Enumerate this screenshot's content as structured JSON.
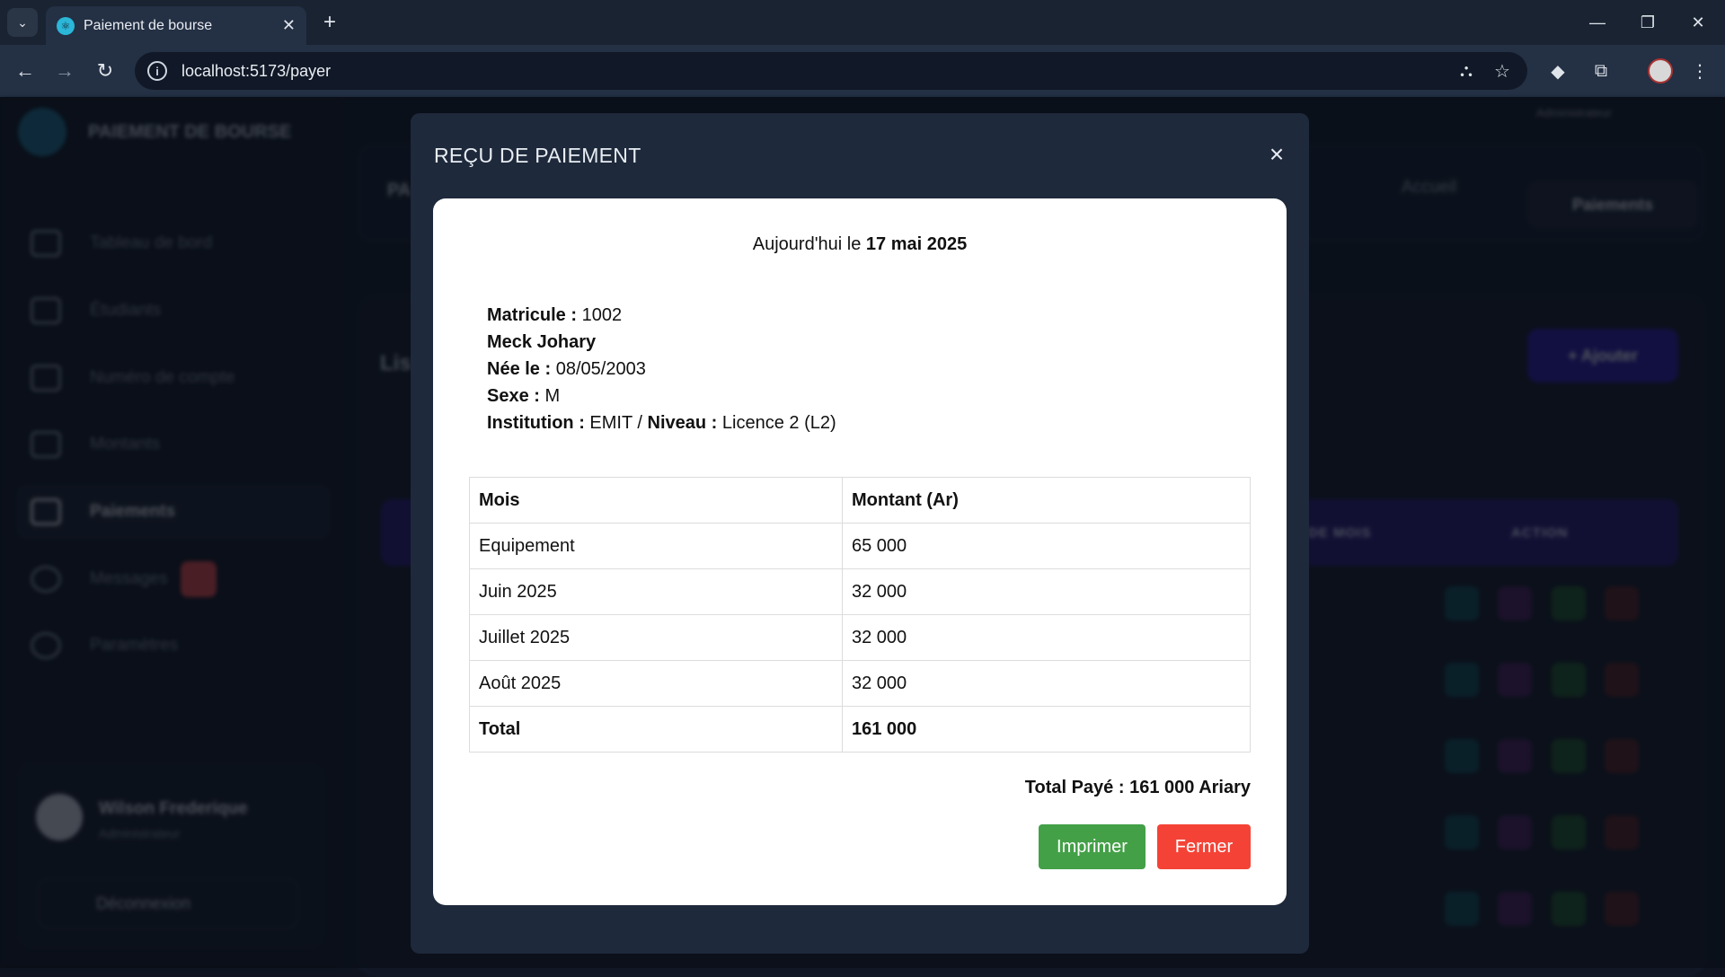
{
  "browser": {
    "tab_title": "Paiement de bourse",
    "url": "localhost:5173/payer"
  },
  "app": {
    "brand": "PAIEMENT DE BOURSE",
    "sidebar": {
      "items": [
        {
          "label": "Tableau de bord",
          "active": false
        },
        {
          "label": "Étudiants",
          "active": false
        },
        {
          "label": "Numéro de compte",
          "active": false
        },
        {
          "label": "Montants",
          "active": false
        },
        {
          "label": "Paiements",
          "active": true
        },
        {
          "label": "Messages",
          "active": false
        },
        {
          "label": "Paramètres",
          "active": false
        }
      ]
    },
    "user": {
      "name": "Wilson Frederique",
      "role": "Administrateur",
      "logout": "Déconnexion"
    },
    "header": {
      "breadcrumb_home": "Accueil",
      "breadcrumb_current": "Paiements",
      "page_title": "PA",
      "role": "Administrateur"
    },
    "list": {
      "title": "Lis",
      "add_label": "+ Ajouter",
      "col_months": "DE MOIS",
      "col_action": "ACTION"
    }
  },
  "modal": {
    "title": "REÇU DE PAIEMENT",
    "close_glyph": "×",
    "date_prefix": "Aujourd'hui le",
    "date_value": "17 mai 2025",
    "student": {
      "matricule_label": "Matricule :",
      "matricule": "1002",
      "name": "Meck Johary",
      "birth_label": "Née le :",
      "birth": "08/05/2003",
      "sex_label": "Sexe :",
      "sex": "M",
      "institution_label": "Institution :",
      "institution": "EMIT",
      "separator": "/",
      "level_label": "Niveau :",
      "level": "Licence 2 (L2)"
    },
    "table": {
      "headers": [
        "Mois",
        "Montant (Ar)"
      ],
      "rows": [
        {
          "month": "Equipement",
          "amount": "65 000"
        },
        {
          "month": "Juin 2025",
          "amount": "32 000"
        },
        {
          "month": "Juillet 2025",
          "amount": "32 000"
        },
        {
          "month": "Août 2025",
          "amount": "32 000"
        }
      ],
      "total_label": "Total",
      "total_value": "161 000"
    },
    "total_paid": "Total Payé : 161 000 Ariary",
    "print_label": "Imprimer",
    "close_label": "Fermer"
  }
}
